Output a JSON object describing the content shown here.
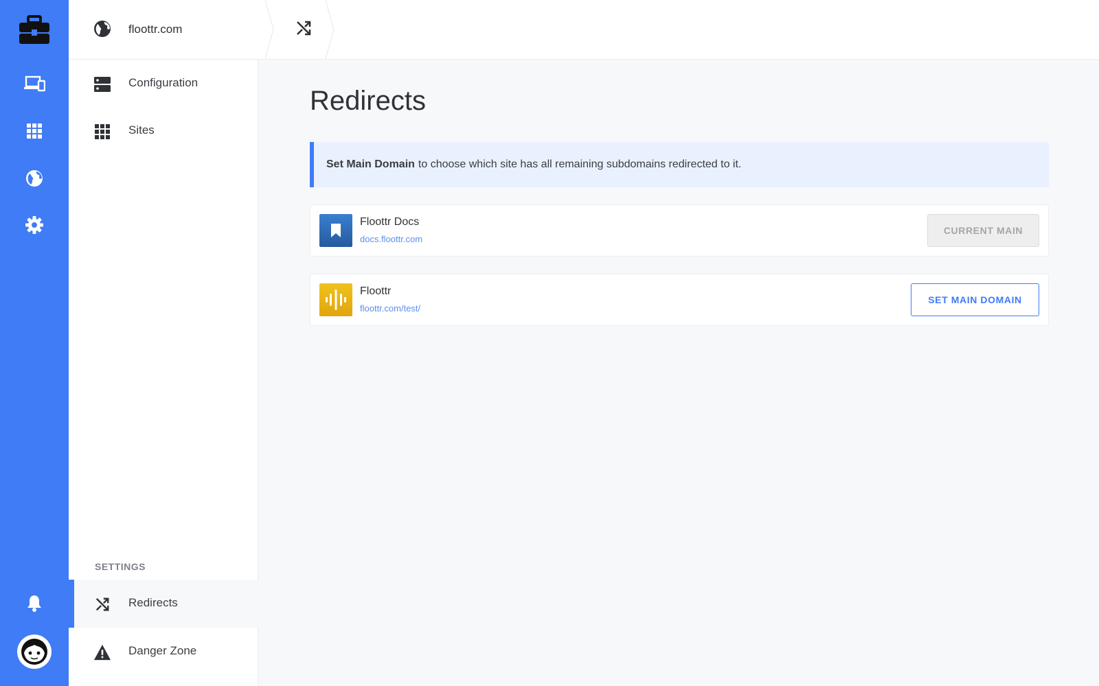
{
  "breadcrumb": {
    "site": "floottr.com"
  },
  "subnav": {
    "items": [
      {
        "label": "Configuration",
        "icon": "server-icon"
      },
      {
        "label": "Sites",
        "icon": "grid-icon"
      }
    ],
    "settings_heading": "SETTINGS",
    "settings_items": [
      {
        "label": "Redirects",
        "icon": "shuffle-icon",
        "active": true
      },
      {
        "label": "Danger Zone",
        "icon": "warning-icon",
        "active": false
      }
    ]
  },
  "main": {
    "title": "Redirects",
    "info_bold": "Set Main Domain",
    "info_text": "to choose which site has all remaining subdomains redirected to it.",
    "sites": [
      {
        "name": "Floottr Docs",
        "url": "docs.floottr.com",
        "button": "CURRENT MAIN",
        "thumb_color": "#2f66b4",
        "is_main": true
      },
      {
        "name": "Floottr",
        "url": "floottr.com/test/",
        "button": "SET MAIN DOMAIN",
        "thumb_color": "#e8b415",
        "is_main": false
      }
    ]
  },
  "colors": {
    "accent": "#3f7cf5",
    "info_bg": "#eaf1fe"
  }
}
